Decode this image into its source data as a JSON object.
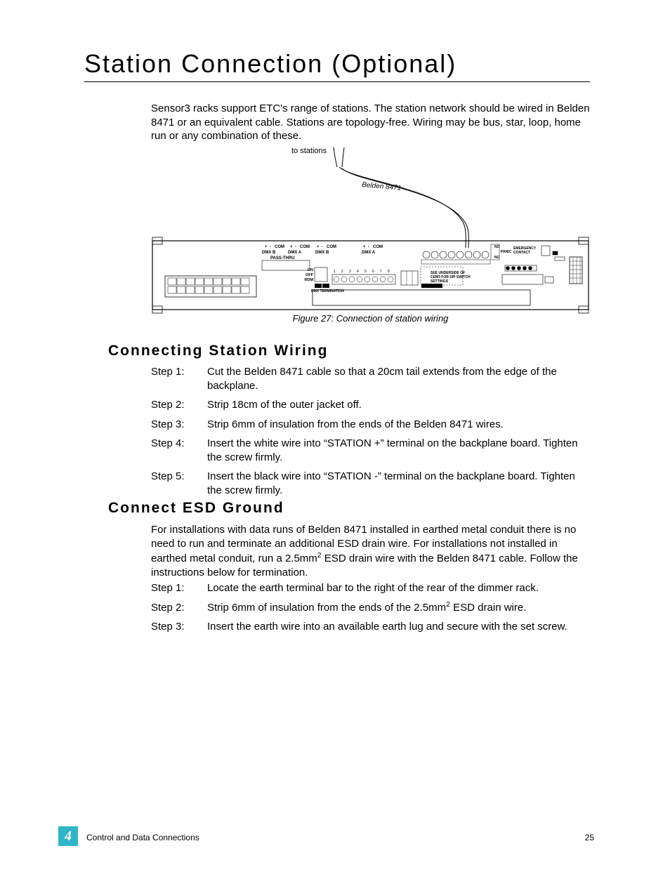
{
  "title": "Station Connection (Optional)",
  "intro": "Sensor3 racks support ETC's range of stations. The station network should be wired in Belden 8471 or an equivalent cable. Stations are topology-free. Wiring may be bus, star, loop, home run or any combination of these.",
  "figure": {
    "to_stations": "to stations",
    "cable_label": "Belden 8471",
    "caption": "Figure 27: Connection of station wiring",
    "panel": {
      "dmx_b_1": "DMX B",
      "dmx_a_1": "DMX A",
      "passthru": "PASS-THRU",
      "dmx_b_2": "DMX B",
      "dmx_a_2": "DMX A",
      "com": "COM",
      "plus": "+",
      "minus": "-",
      "on": "ON",
      "off": "OFF",
      "rdm": "RDM",
      "dmx_term": "DMX TERMINATION",
      "no": "NO",
      "nc": "NC",
      "panic": "PANIC",
      "emerg": "EMERGENCY",
      "contact": "CONTACT",
      "dipnote1": "SEE UNDERSIDE OF",
      "dipnote2": "CEM3 FOR DIP SWITCH",
      "dipnote3": "SETTINGS"
    }
  },
  "section1": {
    "heading": "Connecting Station Wiring",
    "steps": [
      {
        "label": "Step 1:",
        "text": "Cut the Belden 8471 cable so that a 20cm tail extends from the edge of the backplane."
      },
      {
        "label": "Step 2:",
        "text": "Strip 18cm of the outer jacket off."
      },
      {
        "label": "Step 3:",
        "text": "Strip 6mm of insulation from the ends of the Belden 8471 wires."
      },
      {
        "label": "Step 4:",
        "text": "Insert the white wire into “STATION +” terminal on the backplane board. Tighten the screw firmly."
      },
      {
        "label": "Step 5:",
        "text": "Insert the black wire into “STATION -” terminal on the backplane board. Tighten the screw firmly."
      }
    ]
  },
  "section2": {
    "heading": "Connect ESD Ground",
    "intro_pre": "For installations with data runs of Belden 8471 installed in earthed metal conduit there is no need to run and terminate an additional ESD drain wire. For installations not installed in earthed metal conduit, run a 2.5mm",
    "intro_sup": "2",
    "intro_post": " ESD drain wire with the Belden 8471 cable. Follow the instructions below for termination.",
    "steps": [
      {
        "label": "Step 1:",
        "text": "Locate the earth terminal bar to the right of the rear of the dimmer rack."
      },
      {
        "label": "Step 2:",
        "pre": "Strip 6mm of insulation from the ends of the 2.5mm",
        "sup": "2",
        "post": " ESD drain wire."
      },
      {
        "label": "Step 3:",
        "text": "Insert the earth wire into an available earth lug and secure with the set screw."
      }
    ]
  },
  "footer": {
    "chapter_num": "4",
    "section": "Control and Data Connections",
    "page": "25"
  }
}
